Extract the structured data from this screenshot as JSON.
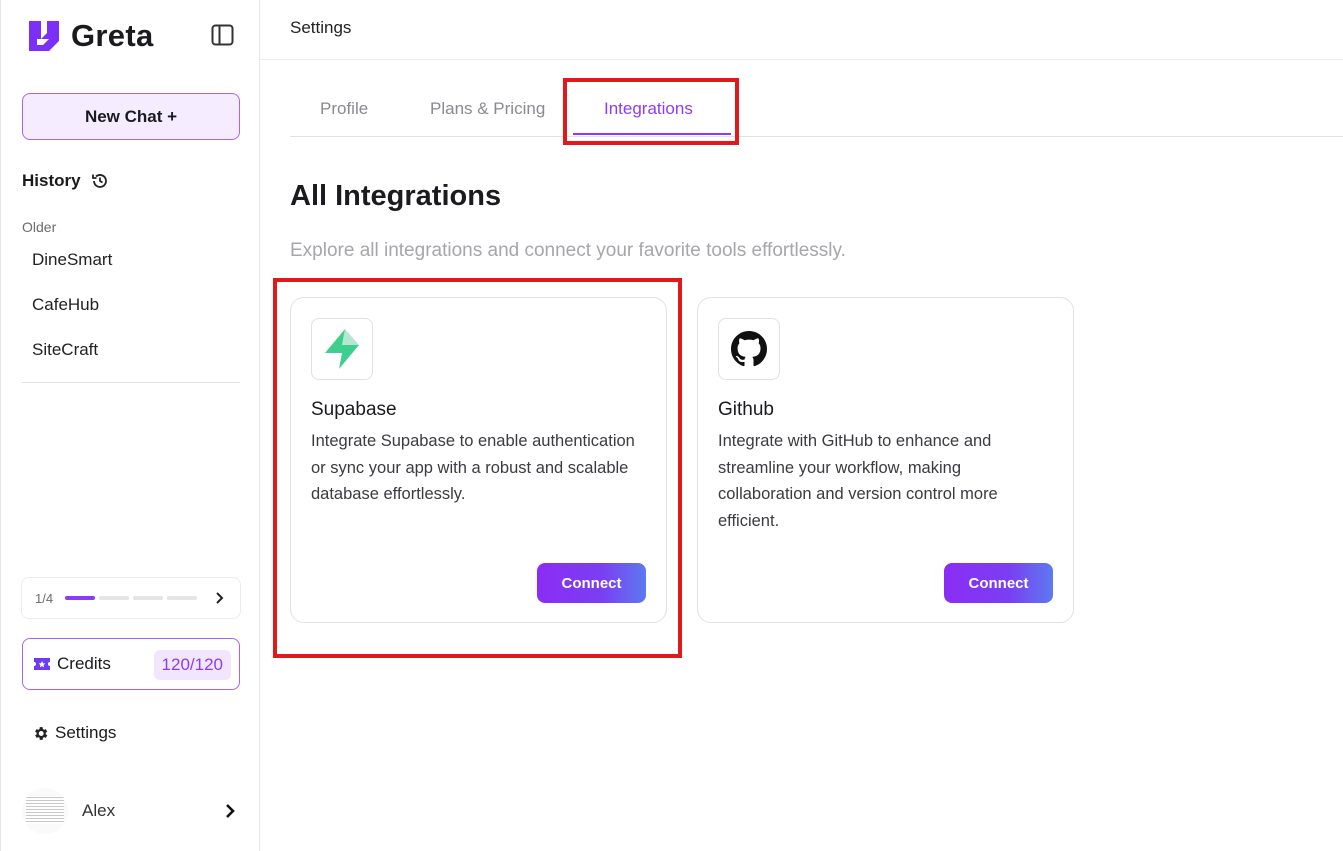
{
  "app": {
    "name": "Greta"
  },
  "sidebar": {
    "new_chat_label": "New Chat +",
    "history_label": "History",
    "older_label": "Older",
    "history_items": [
      "DineSmart",
      "CafeHub",
      "SiteCraft"
    ],
    "progress": {
      "text": "1/4",
      "completed": 1,
      "total": 4
    },
    "credits": {
      "label": "Credits",
      "value": "120/120"
    },
    "settings_label": "Settings",
    "user": {
      "name": "Alex"
    }
  },
  "header": {
    "title": "Settings"
  },
  "tabs": [
    {
      "label": "Profile",
      "active": false
    },
    {
      "label": "Plans & Pricing",
      "active": false
    },
    {
      "label": "Integrations",
      "active": true
    }
  ],
  "main": {
    "title": "All Integrations",
    "subtitle": "Explore all integrations and connect your favorite tools effortlessly.",
    "integrations": [
      {
        "name": "Supabase",
        "icon": "supabase-icon",
        "description": "Integrate Supabase to enable authentication or sync your app with a robust and scalable database effortlessly.",
        "button_label": "Connect"
      },
      {
        "name": "Github",
        "icon": "github-icon",
        "description": "Integrate with GitHub to enhance and streamline your workflow, making collaboration and version control more efficient.",
        "button_label": "Connect"
      }
    ]
  },
  "colors": {
    "accent": "#8b3cf7",
    "highlight": "#e0191a",
    "supabase_green": "#3ecf8e"
  }
}
